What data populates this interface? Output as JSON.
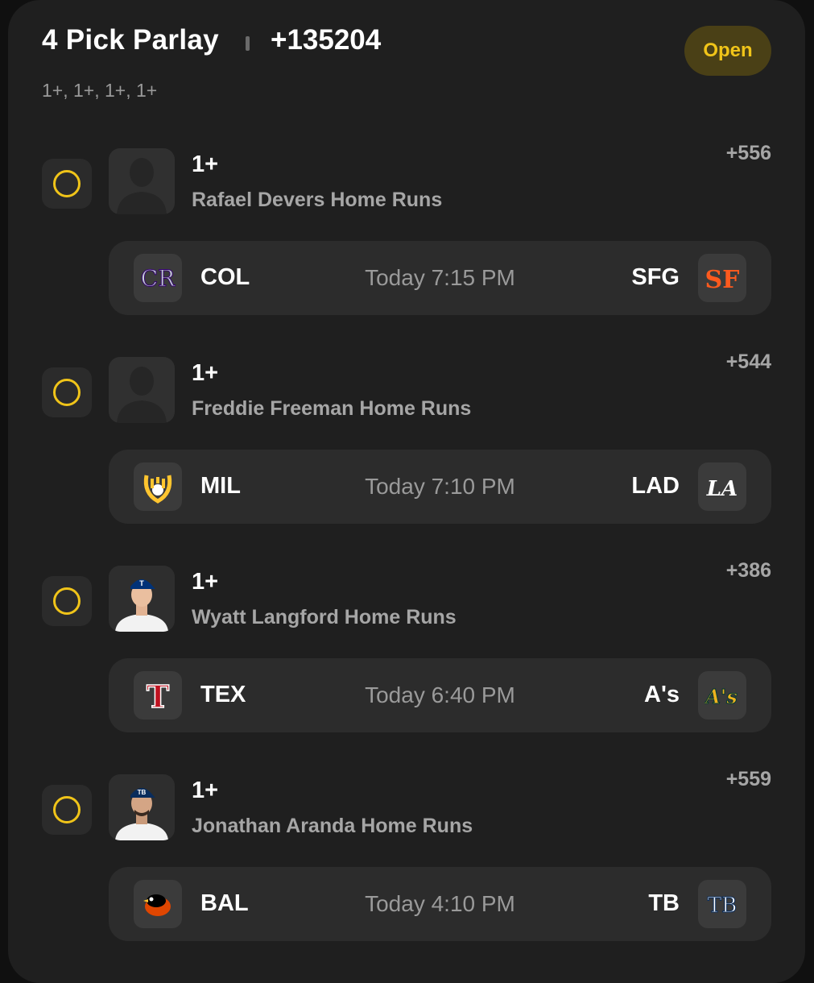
{
  "header": {
    "title": "4 Pick Parlay",
    "odds": "+135204",
    "legs_summary": "1+, 1+, 1+, 1+",
    "status": "Open"
  },
  "colors": {
    "accent": "#f0c419",
    "background": "#1f1f1f",
    "panel": "#2c2c2c",
    "muted_text": "#a6a6a6"
  },
  "legs": [
    {
      "line": "1+",
      "market": "Rafael Devers Home Runs",
      "odds": "+556",
      "avatar": "placeholder-silhouette",
      "game": {
        "away": "COL",
        "time": "Today 7:15 PM",
        "home": "SFG",
        "away_logo": "rockies-logo",
        "home_logo": "giants-logo"
      }
    },
    {
      "line": "1+",
      "market": "Freddie Freeman Home Runs",
      "odds": "+544",
      "avatar": "placeholder-silhouette",
      "game": {
        "away": "MIL",
        "time": "Today 7:10 PM",
        "home": "LAD",
        "away_logo": "brewers-logo",
        "home_logo": "dodgers-logo"
      }
    },
    {
      "line": "1+",
      "market": "Wyatt Langford Home Runs",
      "odds": "+386",
      "avatar": "player-photo",
      "game": {
        "away": "TEX",
        "time": "Today 6:40 PM",
        "home": "A's",
        "away_logo": "rangers-logo",
        "home_logo": "athletics-logo"
      }
    },
    {
      "line": "1+",
      "market": "Jonathan Aranda Home Runs",
      "odds": "+559",
      "avatar": "player-photo",
      "game": {
        "away": "BAL",
        "time": "Today 4:10 PM",
        "home": "TB",
        "away_logo": "orioles-logo",
        "home_logo": "rays-logo"
      }
    }
  ]
}
